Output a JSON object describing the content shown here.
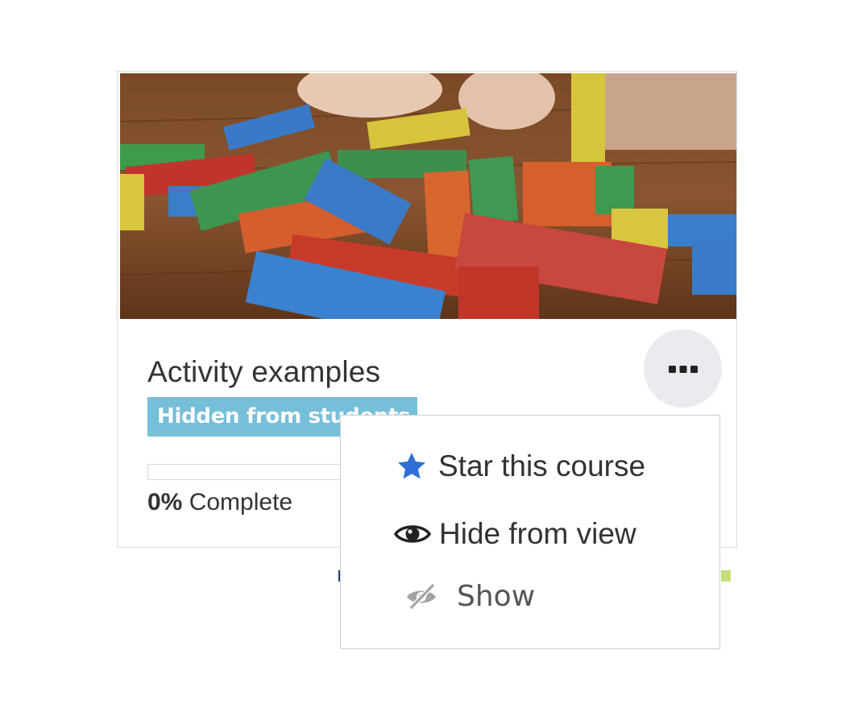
{
  "course": {
    "title": "Activity examples",
    "badge": "Hidden from students",
    "progress": {
      "percent": 0,
      "percent_label": "0%",
      "suffix": " Complete"
    },
    "image_icon": "colorful-wooden-blocks-image"
  },
  "actions_button": {
    "icon": "ellipsis-icon"
  },
  "menu": {
    "items": [
      {
        "label": "Star this course",
        "icon": "star-icon",
        "color": "#2f6fd6"
      },
      {
        "label": "Hide from view",
        "icon": "eye-icon",
        "color": "#222222"
      },
      {
        "label": "Show",
        "icon": "eye-slash-icon",
        "color": "#9a9a9a"
      }
    ]
  },
  "colors": {
    "badge": "#76bfd9",
    "button_bg": "#e9ebee",
    "text": "#333333"
  }
}
